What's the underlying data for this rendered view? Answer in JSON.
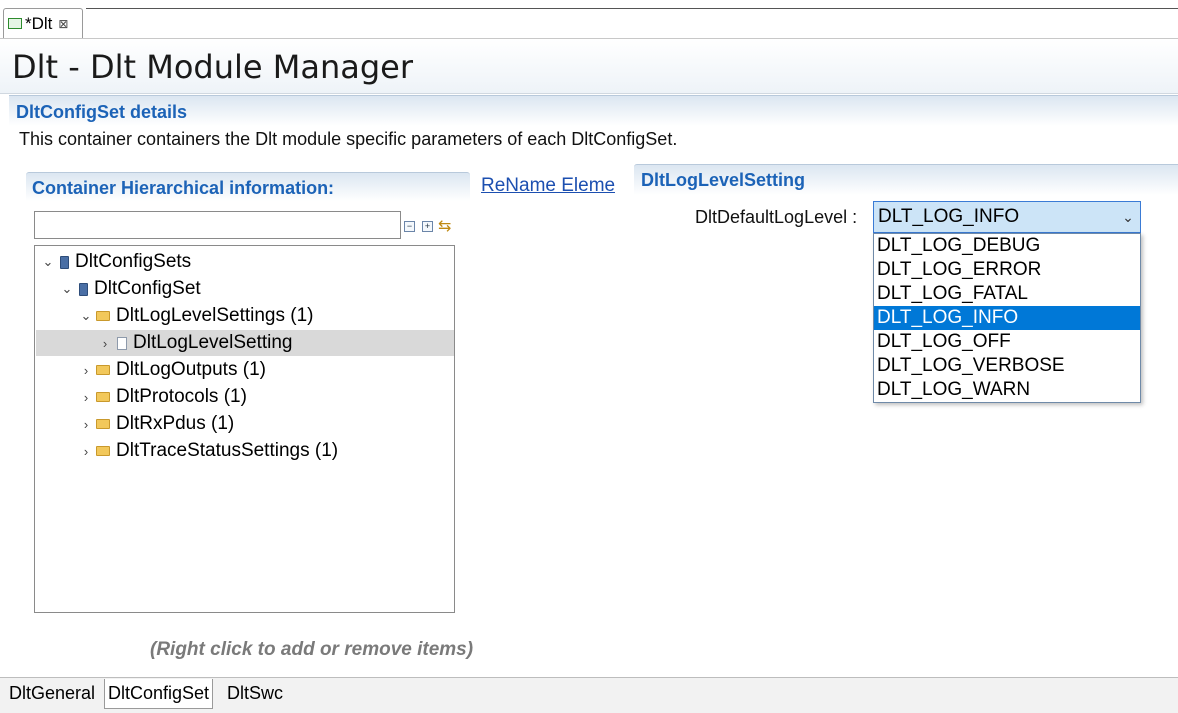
{
  "editor_tab": {
    "label": "*Dlt",
    "close_glyph": "⊠"
  },
  "header": {
    "title": "Dlt - Dlt Module Manager"
  },
  "section": {
    "title": "DltConfigSet details",
    "description": "This container containers the Dlt module specific parameters of each DltConfigSet."
  },
  "hierarchy": {
    "title": "Container Hierarchical information:",
    "filter_value": "",
    "tree": [
      {
        "label": "DltConfigSets",
        "level": 0,
        "toggle": "expanded",
        "icon": "module-icon"
      },
      {
        "label": "DltConfigSet",
        "level": 1,
        "toggle": "expanded",
        "icon": "module-icon"
      },
      {
        "label": "DltLogLevelSettings (1)",
        "level": 2,
        "toggle": "expanded",
        "icon": "folder-icon"
      },
      {
        "label": "DltLogLevelSetting",
        "level": 3,
        "toggle": "collapsed",
        "icon": "document-icon",
        "selected": true
      },
      {
        "label": "DltLogOutputs (1)",
        "level": 2,
        "toggle": "collapsed",
        "icon": "folder-icon"
      },
      {
        "label": "DltProtocols (1)",
        "level": 2,
        "toggle": "collapsed",
        "icon": "folder-icon"
      },
      {
        "label": "DltRxPdus (1)",
        "level": 2,
        "toggle": "collapsed",
        "icon": "folder-icon"
      },
      {
        "label": "DltTraceStatusSettings (1)",
        "level": 2,
        "toggle": "collapsed",
        "icon": "folder-icon"
      }
    ],
    "hint": "(Right click to add or remove items)"
  },
  "rename_link": "ReName Elemen",
  "detail": {
    "title": "DltLogLevelSetting",
    "field_label": "DltDefaultLogLevel :",
    "selected_value": "DLT_LOG_INFO",
    "options": [
      "DLT_LOG_DEBUG",
      "DLT_LOG_ERROR",
      "DLT_LOG_FATAL",
      "DLT_LOG_INFO",
      "DLT_LOG_OFF",
      "DLT_LOG_VERBOSE",
      "DLT_LOG_WARN"
    ],
    "highlighted_option": "DLT_LOG_INFO"
  },
  "bottom_tabs": [
    {
      "label": "DltGeneral",
      "active": false
    },
    {
      "label": "DltConfigSet",
      "active": true
    },
    {
      "label": "DltSwc",
      "active": false
    }
  ],
  "colors": {
    "section_title": "#1c63b7",
    "highlight": "#0078d7",
    "link": "#1c4fb0"
  }
}
